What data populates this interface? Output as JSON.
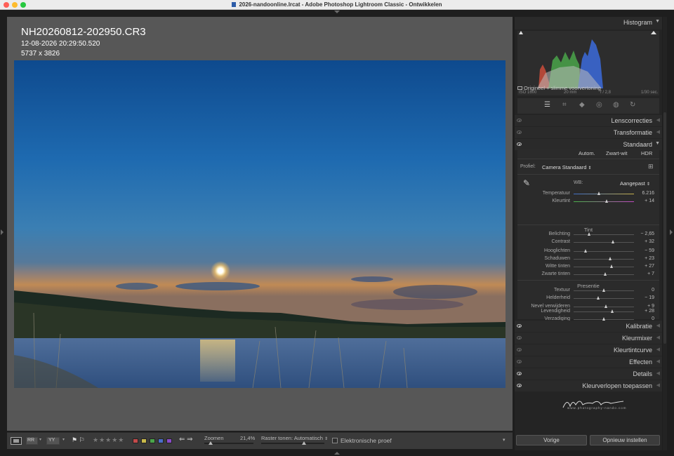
{
  "window": {
    "title": "2026-nandoonline.lrcat - Adobe Photoshop Lightroom Classic - Ontwikkelen"
  },
  "photo_info": {
    "filename": "NH20260812-202950.CR3",
    "datetime": "12-08-2026 20:29:50.520",
    "dimensions": "5737 x 3826"
  },
  "histogram": {
    "title": "Histogram",
    "iso": "ISO 1600",
    "focal": "20 mm",
    "aperture": "f / 2,8",
    "shutter": "1/30 sec.",
    "original_label": "Origineel + slimme voorvertoning"
  },
  "panels": {
    "lenscorrecties": "Lenscorrecties",
    "transformatie": "Transformatie",
    "standaard": "Standaard",
    "kalibratie": "Kalibratie",
    "kleurmixer": "Kleurmixer",
    "kleurtintcurve": "Kleurtintcurve",
    "effecten": "Effecten",
    "details": "Details",
    "kleurverlopen": "Kleurverlopen toepassen"
  },
  "basic": {
    "autom": "Autom.",
    "zwartwit": "Zwart-wit",
    "hdr": "HDR",
    "profiel_label": "Profiel:",
    "profiel_value": "Camera Standaard",
    "wb_label": "WB:",
    "wb_value": "Aangepast",
    "tint_header": "Tint",
    "presentie_header": "Presentie",
    "sliders": [
      {
        "label": "Temperatuur",
        "value": "6.216",
        "pos": 0.42
      },
      {
        "label": "Kleurtint",
        "value": "+ 14",
        "pos": 0.55
      },
      {
        "label": "Belichting",
        "value": "− 2,65",
        "pos": 0.26
      },
      {
        "label": "Contrast",
        "value": "+ 32",
        "pos": 0.66
      },
      {
        "label": "Hooglichten",
        "value": "− 59",
        "pos": 0.2
      },
      {
        "label": "Schaduwen",
        "value": "+ 23",
        "pos": 0.61
      },
      {
        "label": "Witte tinten",
        "value": "+ 27",
        "pos": 0.63
      },
      {
        "label": "Zwarte tinten",
        "value": "+ 7",
        "pos": 0.53
      },
      {
        "label": "Textuur",
        "value": "0",
        "pos": 0.5
      },
      {
        "label": "Helderheid",
        "value": "− 19",
        "pos": 0.41
      },
      {
        "label": "Nevel verwijderen",
        "value": "+ 9",
        "pos": 0.54
      },
      {
        "label": "Levendigheid",
        "value": "+ 28",
        "pos": 0.64
      },
      {
        "label": "Verzadiging",
        "value": "0",
        "pos": 0.5
      }
    ]
  },
  "toolbar": {
    "zoom_label": "Zoomen",
    "zoom_value": "21,4%",
    "raster_label": "Raster tonen:",
    "raster_value": "Automatisch",
    "proof_label": "Elektronische proef"
  },
  "buttons": {
    "vorige": "Vorige",
    "opnieuw": "Opnieuw instellen"
  },
  "watermark": {
    "domain": "www.photography-nando.com"
  },
  "colors": {
    "panel_bg": "#242424",
    "center_bg": "#575757",
    "accent_label": "#cfcfcf"
  }
}
